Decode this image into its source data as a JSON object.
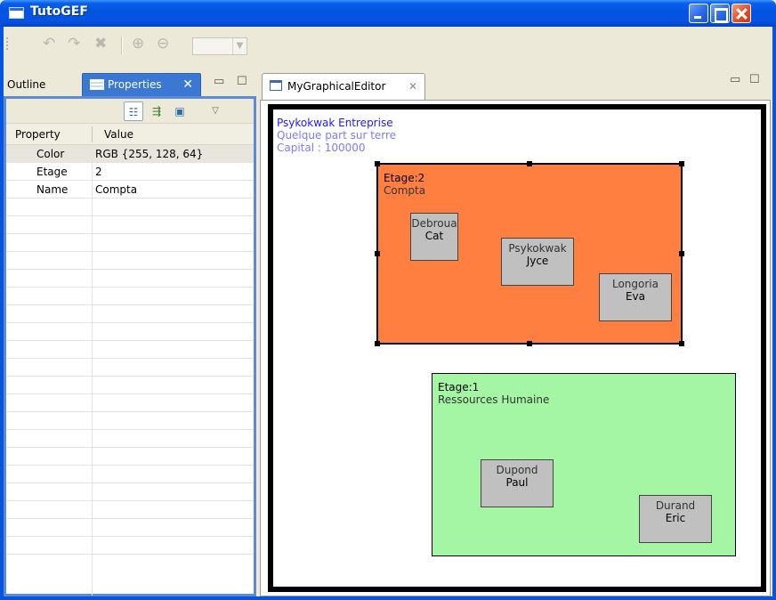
{
  "window": {
    "title": "TutoGEF"
  },
  "toolbar": {
    "icons": [
      "undo-icon",
      "redo-icon",
      "delete-icon",
      "zoom-in-icon",
      "zoom-out-icon"
    ],
    "zoom_value": ""
  },
  "left_view": {
    "tabs": [
      {
        "label": "Outline",
        "active": false
      },
      {
        "label": "Properties",
        "active": true
      }
    ],
    "properties": {
      "columns": [
        "Property",
        "Value"
      ],
      "rows": [
        {
          "name": "Color",
          "value": "RGB {255, 128, 64}",
          "selected": true
        },
        {
          "name": "Etage",
          "value": "2",
          "selected": false
        },
        {
          "name": "Name",
          "value": "Compta",
          "selected": false
        }
      ]
    }
  },
  "editor": {
    "tab_label": "MyGraphicalEditor",
    "enterprise": {
      "name": "Psykokwak Entreprise",
      "address": "Quelque part sur terre",
      "capital": "Capital : 100000"
    },
    "services": [
      {
        "etage": "Etage:2",
        "name": "Compta",
        "color": "#ff7f40",
        "selected": true,
        "employees": [
          {
            "last": "Debroua",
            "first": "Cat"
          },
          {
            "last": "Psykokwak",
            "first": "Jyce"
          },
          {
            "last": "Longoria",
            "first": "Eva"
          }
        ]
      },
      {
        "etage": "Etage:1",
        "name": "Ressources Humaine",
        "color": "#a4f5a4",
        "selected": false,
        "employees": [
          {
            "last": "Dupond",
            "first": "Paul"
          },
          {
            "last": "Durand",
            "first": "Eric"
          }
        ]
      }
    ]
  },
  "colors": {
    "titlebar": "#0454e2",
    "active_tab": "#3a78d4",
    "enterprise_name": "#1a1aff",
    "enterprise_info": "#7b7bff",
    "employee_box": "#c0c0c0"
  }
}
